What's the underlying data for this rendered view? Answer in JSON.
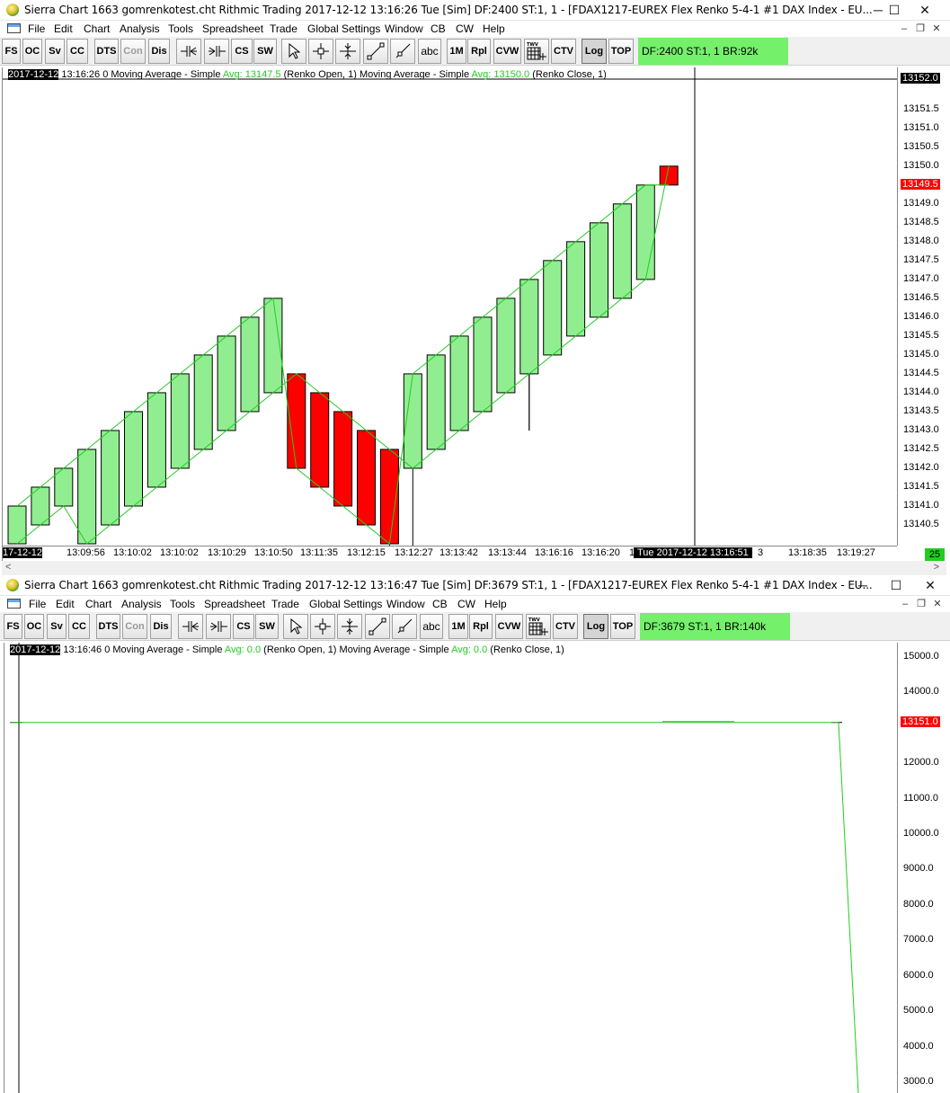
{
  "window1": {
    "title": "Sierra Chart 1663 gomrenkotest.cht  Rithmic Trading 2017-12-12  13:16:26 Tue [Sim]  DF:2400  ST:1, 1 - [FDAX1217-EUREX  Flex Renko 5-4-1  #1  DAX Index - EU...",
    "info": "DF:2400  ST:1, 1  BR:92k",
    "header": {
      "date": "2017-12-12",
      "time": " 13:16:26 0  Moving Average - Simple  ",
      "avg1_label": "Avg: 13147.5",
      "mid": "  (Renko Open, 1)  Moving Average - Simple  ",
      "avg2_label": "Avg: 13150.0",
      "tail": "  (Renko Close, 1)"
    },
    "y_labels": [
      "13151.5",
      "13151.0",
      "13150.5",
      "13150.0",
      "13149.0",
      "13148.5",
      "13148.0",
      "13147.5",
      "13147.0",
      "13146.5",
      "13146.0",
      "13145.5",
      "13145.0",
      "13144.5",
      "13144.0",
      "13143.5",
      "13143.0",
      "13142.5",
      "13142.0",
      "13141.5",
      "13141.0",
      "13140.5"
    ],
    "y_top_label": "13152.0",
    "y_price_label": "13149.5",
    "x_labels": [
      "17-12-12",
      "13:09:56",
      "13:10:02",
      "13:10:02",
      "13:10:29",
      "13:10:50",
      "13:11:35",
      "13:12:15",
      "13:12:27",
      "13:13:42",
      "13:13:44",
      "13:16:16",
      "13:16:20",
      "1",
      "3",
      "13:18:35",
      "13:19:27"
    ],
    "x_cursor_label": "Tue 2017-12-12  13:16:51",
    "corner_badge": "25",
    "chart_data": {
      "type": "renko",
      "y_range": [
        13140,
        13152.2
      ],
      "bricks": [
        {
          "open": 13140.0,
          "close": 13141.0,
          "dir": "up"
        },
        {
          "open": 13140.5,
          "close": 13141.5,
          "dir": "up"
        },
        {
          "open": 13141.0,
          "close": 13142.0,
          "dir": "up"
        },
        {
          "open": 13140.0,
          "close": 13142.5,
          "dir": "up"
        },
        {
          "open": 13140.5,
          "close": 13143.0,
          "dir": "up"
        },
        {
          "open": 13141.0,
          "close": 13143.5,
          "dir": "up"
        },
        {
          "open": 13141.5,
          "close": 13144.0,
          "dir": "up"
        },
        {
          "open": 13142.0,
          "close": 13144.5,
          "dir": "up"
        },
        {
          "open": 13142.5,
          "close": 13145.0,
          "dir": "up"
        },
        {
          "open": 13143.0,
          "close": 13145.5,
          "dir": "up"
        },
        {
          "open": 13143.5,
          "close": 13146.0,
          "dir": "up"
        },
        {
          "open": 13144.0,
          "close": 13146.5,
          "dir": "up"
        },
        {
          "open": 13144.5,
          "close": 13142.0,
          "dir": "down"
        },
        {
          "open": 13144.0,
          "close": 13141.5,
          "dir": "down"
        },
        {
          "open": 13143.5,
          "close": 13141.0,
          "dir": "down"
        },
        {
          "open": 13143.0,
          "close": 13140.5,
          "dir": "down"
        },
        {
          "open": 13142.5,
          "close": 13140.0,
          "dir": "down",
          "low": 13139.8
        },
        {
          "open": 13142.0,
          "close": 13144.5,
          "dir": "up",
          "low": 13139.8
        },
        {
          "open": 13142.5,
          "close": 13145.0,
          "dir": "up"
        },
        {
          "open": 13143.0,
          "close": 13145.5,
          "dir": "up"
        },
        {
          "open": 13143.5,
          "close": 13146.0,
          "dir": "up"
        },
        {
          "open": 13144.0,
          "close": 13146.5,
          "dir": "up"
        },
        {
          "open": 13144.5,
          "close": 13147.0,
          "dir": "up",
          "low": 13143.0
        },
        {
          "open": 13145.0,
          "close": 13147.5,
          "dir": "up"
        },
        {
          "open": 13145.5,
          "close": 13148.0,
          "dir": "up"
        },
        {
          "open": 13146.0,
          "close": 13148.5,
          "dir": "up"
        },
        {
          "open": 13146.5,
          "close": 13149.0,
          "dir": "up"
        },
        {
          "open": 13147.0,
          "close": 13149.5,
          "dir": "up"
        },
        {
          "open": 13150.0,
          "close": 13149.5,
          "dir": "down"
        }
      ]
    }
  },
  "window2": {
    "title": "Sierra Chart 1663 gomrenkotest.cht  Rithmic Trading 2017-12-12  13:16:47 Tue [Sim]  DF:3679  ST:1, 1 - [FDAX1217-EUREX  Flex Renko 5-4-1  #1  DAX Index - EU...",
    "info": "DF:3679  ST:1, 1  BR:140k",
    "header": {
      "date": "2017-12-12",
      "time": " 13:16:46 0  Moving Average - Simple  ",
      "avg1_label": "Avg: 0.0",
      "mid": "  (Renko Open, 1)  Moving Average - Simple  ",
      "avg2_label": "Avg: 0.0",
      "tail": "  (Renko Close, 1)"
    },
    "y_labels": [
      "15000.0",
      "14000.0",
      "12000.0",
      "11000.0",
      "10000.0",
      "9000.0",
      "8000.0",
      "7000.0",
      "6000.0",
      "5000.0",
      "4000.0",
      "3000.0"
    ],
    "y_price_label": "13151.0",
    "chart_data": {
      "type": "line",
      "y_range": [
        2700,
        15400
      ],
      "moving_average_level": 13151.0,
      "drop_to": 2700
    }
  },
  "menus": [
    "File",
    "Edit",
    "Chart",
    "Analysis",
    "Tools",
    "Spreadsheet",
    "Trade",
    "Global Settings",
    "Window",
    "CB",
    "CW",
    "Help"
  ],
  "toolbar": {
    "fs": "FS",
    "oc": "OC",
    "sv": "Sv",
    "cc": "CC",
    "dts": "DTS",
    "con": "Con",
    "dis": "Dis",
    "cs": "CS",
    "sw": "SW",
    "abc": "abc",
    "m1": "1M",
    "rpl": "Rpl",
    "cvw": "CVW",
    "ctv": "CTV",
    "log": "Log",
    "top": "TOP"
  },
  "colors": {
    "up": "#90ee90",
    "down": "#ff0000",
    "ma": "#22cc22",
    "info": "#74f06a"
  }
}
